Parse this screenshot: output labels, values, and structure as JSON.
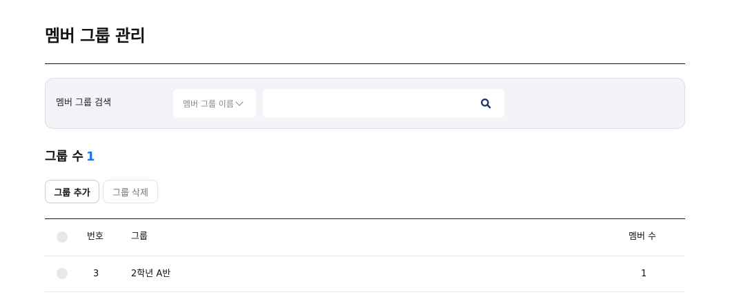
{
  "page": {
    "title": "멤버 그룹 관리"
  },
  "search": {
    "label": "멤버 그룹 검색",
    "select_value": "멤버 그룹 이름",
    "input_value": "",
    "input_placeholder": ""
  },
  "summary": {
    "count_label": "그룹 수",
    "count": "1"
  },
  "actions": {
    "add_label": "그룹 추가",
    "delete_label": "그룹 삭제"
  },
  "table": {
    "headers": {
      "number": "번호",
      "group": "그룹",
      "members": "멤버 수"
    },
    "rows": [
      {
        "number": "3",
        "group": "2학년 A반",
        "members": "1"
      }
    ]
  },
  "colors": {
    "accent": "#1a73e8",
    "icon": "#1f3a6e",
    "panel": "#f3f4f8"
  }
}
